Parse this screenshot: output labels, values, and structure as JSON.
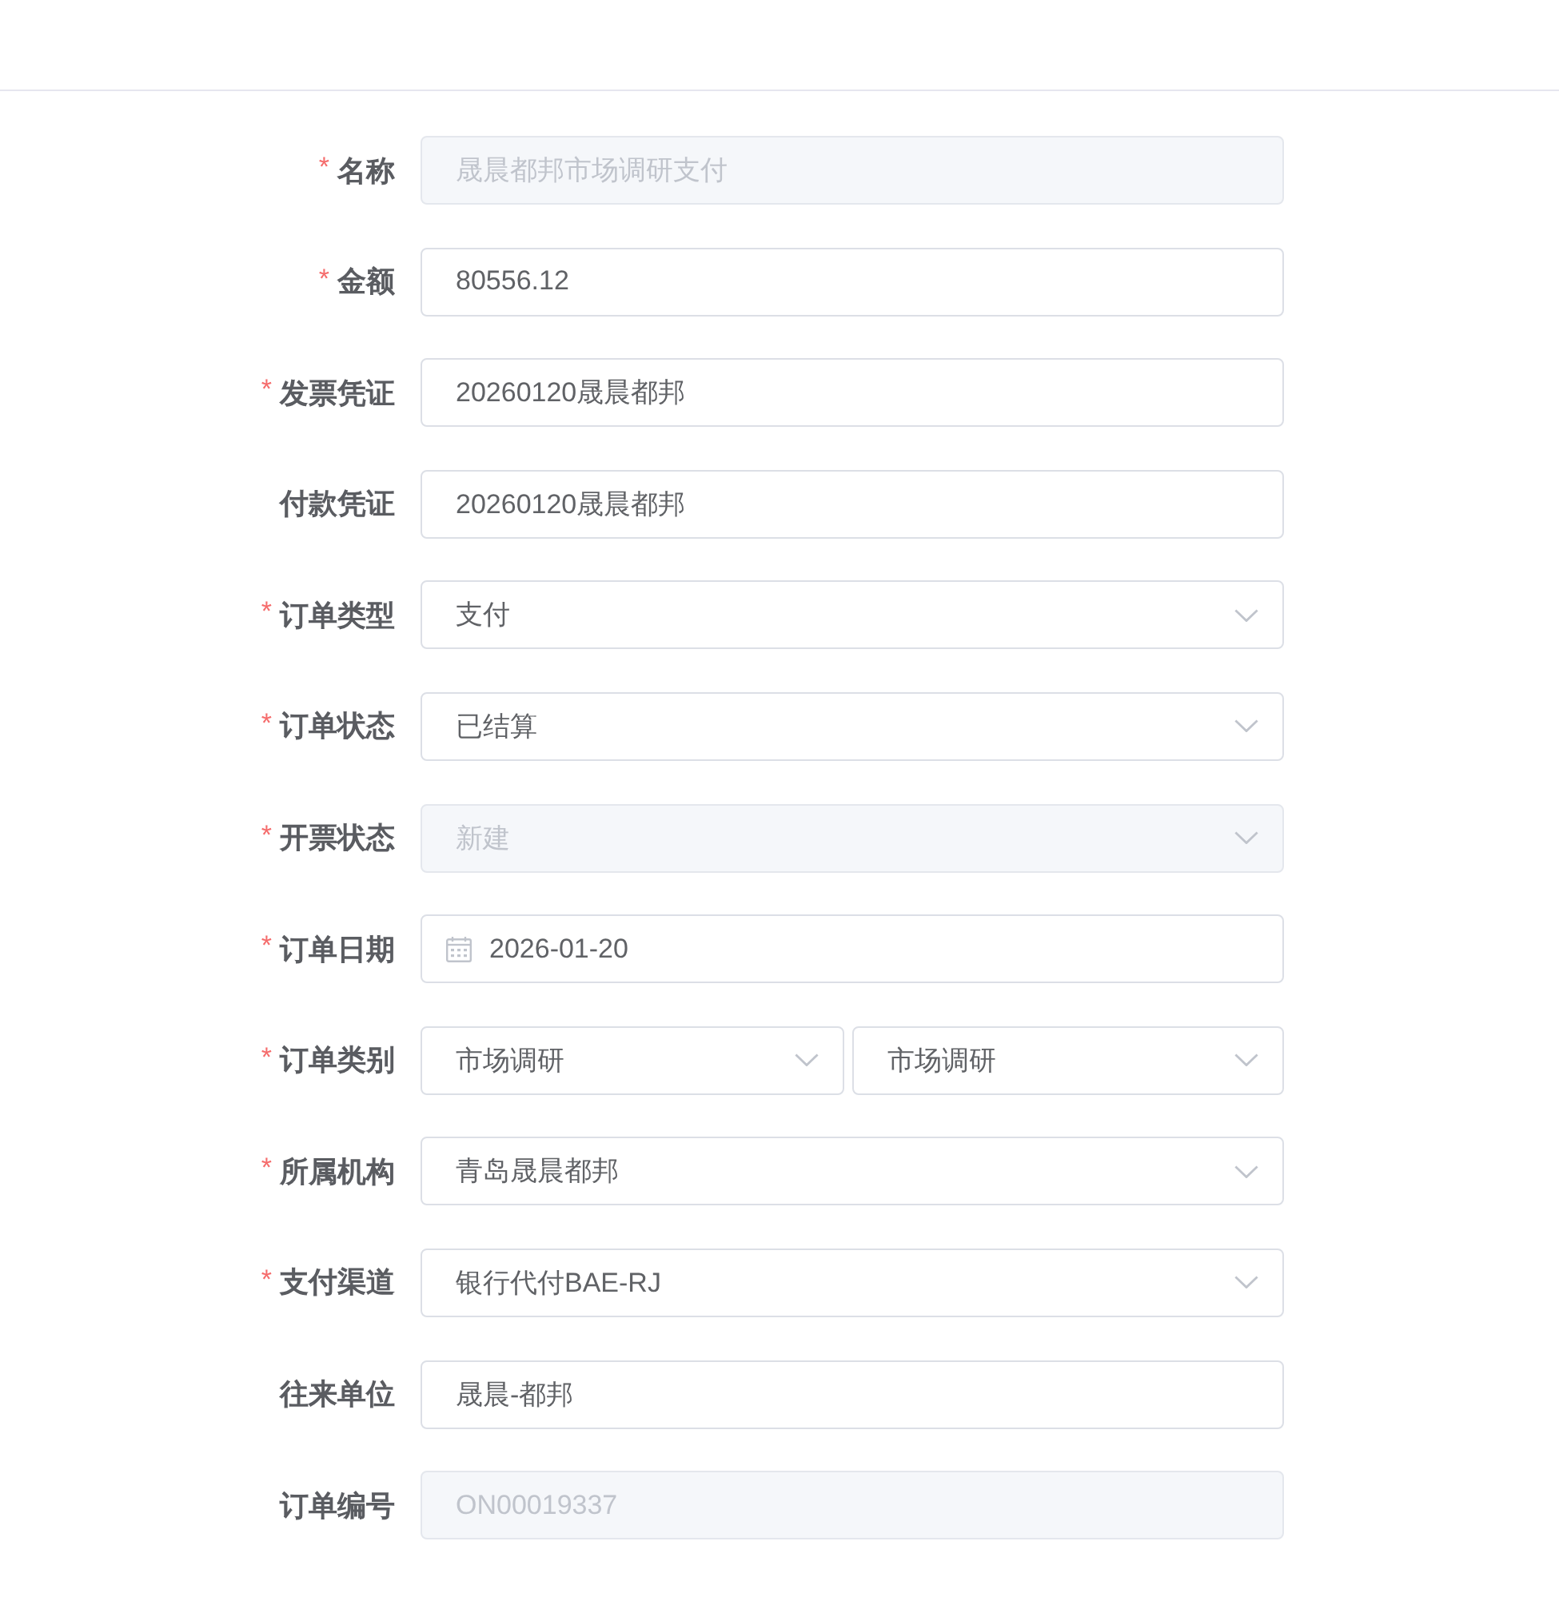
{
  "form": {
    "fields": [
      {
        "kind": "input",
        "required_mark": "*",
        "label": "名称",
        "value": "晟晨都邦市场调研支付",
        "disabled": true
      },
      {
        "kind": "input",
        "required_mark": "*",
        "label": "金额",
        "value": "80556.12",
        "disabled": false
      },
      {
        "kind": "input",
        "required_mark": "*",
        "label": "发票凭证",
        "value": "20260120晟晨都邦",
        "disabled": false
      },
      {
        "kind": "input",
        "label": "付款凭证",
        "value": "20260120晟晨都邦",
        "disabled": false
      },
      {
        "kind": "select",
        "required_mark": "*",
        "label": "订单类型",
        "value": "支付",
        "disabled": false
      },
      {
        "kind": "select",
        "required_mark": "*",
        "label": "订单状态",
        "value": "已结算",
        "disabled": false
      },
      {
        "kind": "select",
        "required_mark": "*",
        "label": "开票状态",
        "value": "新建",
        "disabled": true
      },
      {
        "kind": "date",
        "required_mark": "*",
        "label": "订单日期",
        "value": "2026-01-20",
        "disabled": false
      },
      {
        "kind": "select_pair",
        "required_mark": "*",
        "label": "订单类别",
        "values": [
          "市场调研",
          "市场调研"
        ],
        "disabled": false
      },
      {
        "kind": "select",
        "required_mark": "*",
        "label": "所属机构",
        "value": "青岛晟晨都邦",
        "disabled": false
      },
      {
        "kind": "select",
        "required_mark": "*",
        "label": "支付渠道",
        "value": "银行代付BAE-RJ",
        "disabled": false
      },
      {
        "kind": "input",
        "label": "往来单位",
        "value": "晟晨-都邦",
        "disabled": false
      },
      {
        "kind": "input",
        "label": "订单编号",
        "value": "ON00019337",
        "disabled": true
      }
    ]
  }
}
